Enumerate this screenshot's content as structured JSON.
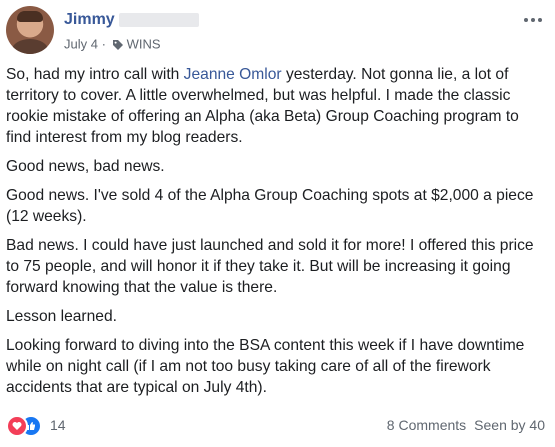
{
  "post": {
    "author": "Jimmy",
    "date": "July 4",
    "separator": "·",
    "group_tag": "WINS",
    "body": {
      "p1_before": "So, had my intro call with ",
      "p1_mention": "Jeanne Omlor",
      "p1_after": " yesterday. Not gonna lie, a lot of territory to cover. A little overwhelmed, but was helpful. I made the classic rookie mistake of offering an Alpha (aka Beta) Group Coaching program to find interest from my blog readers.",
      "p2": "Good news, bad news.",
      "p3": "Good news. I've sold 4 of the Alpha Group Coaching spots at $2,000 a piece (12 weeks).",
      "p4": "Bad news. I could have just launched and sold it for more! I offered this price to 75 people, and will honor it if they take it. But will be increasing it going forward knowing that the value is there.",
      "p5": "Lesson learned.",
      "p6": "Looking forward to diving into the BSA content this week if I have downtime while on night call (if I am not too busy taking care of all of the firework accidents that are typical on July 4th)."
    },
    "footer": {
      "reaction_count": "14",
      "comments": "8 Comments",
      "seen_by": "Seen by 40"
    },
    "icons": {
      "avatar": "avatar",
      "tag": "tag-icon",
      "more": "more-options-icon",
      "love": "love-reaction-icon",
      "like": "like-reaction-icon"
    },
    "colors": {
      "link": "#385898",
      "meta": "#606770",
      "love": "#f33e58",
      "like": "#1877f2"
    }
  }
}
